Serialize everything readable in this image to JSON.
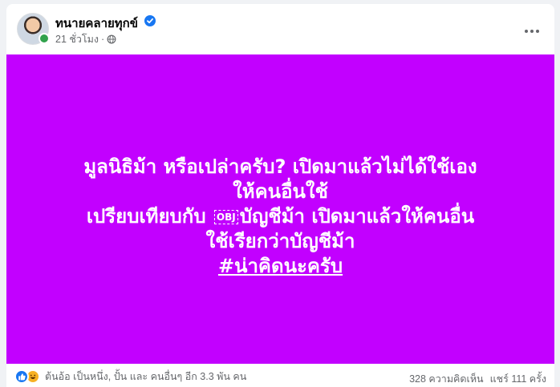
{
  "author": {
    "name": "ทนายคลายทุกข์",
    "verified": true
  },
  "post_meta": {
    "time": "21 ชั่วโมง",
    "separator": "·",
    "privacy_icon": "globe-icon"
  },
  "post": {
    "background_color": "#c200ff",
    "lines": [
      "มูลนิธิม้า หรือเปล่าครับ? เปิดมาแล้วไม่ได้ใช้เอง",
      "ให้คนอื่นใช้",
      "เปรียบเทียบกับ",
      "บัญชีม้า เปิดมาแล้วให้คนอื่น",
      "ใช้เรียกว่าบัญชีม้า",
      "#น่าคิดนะครับ"
    ],
    "placeholder_glyph": "OBJ"
  },
  "footer": {
    "reaction_icons": [
      "like-icon",
      "haha-icon"
    ],
    "reaction_summary": "ต้นอ้อ เป็นหนึ่ง, ปั้น และ คนอื่นๆ อีก 3.3 พัน คน",
    "comments": "328 ความคิดเห็น",
    "shares": "แชร์ 111 ครั้ง"
  },
  "colors": {
    "verified": "#1877f2",
    "online": "#31a24c",
    "like": "#1877f2"
  }
}
